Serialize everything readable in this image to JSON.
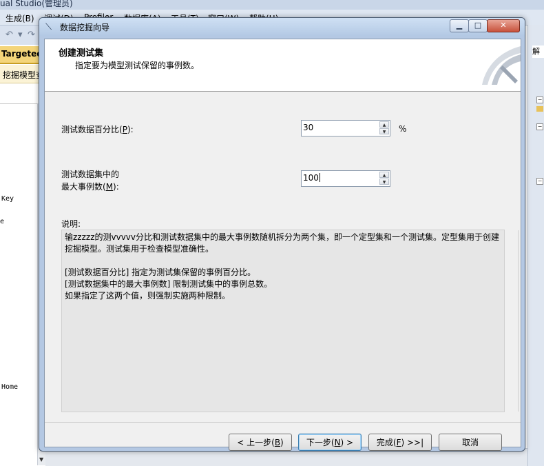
{
  "ide": {
    "title_fragment": "ual Studio(管理员)",
    "menu": [
      "生成(B)",
      "调试(D)",
      "Profiler",
      "数据库(A)",
      "工具(T)",
      "窗口(W)",
      "帮助(H)"
    ],
    "doc_tab_targeted": "Targeted",
    "doc_tab_model": "挖掘模型查",
    "code_fragment_key": "Key",
    "code_fragment_e": "e",
    "code_fragment_home": "Home",
    "right_panel_tab": "解"
  },
  "dialog": {
    "title": "数据挖掘向导",
    "header_title": "创建测试集",
    "header_subtitle": "指定要为模型测试保留的事例数。",
    "percent_label_pre": "测试数据百分比(",
    "percent_label_key": "P",
    "percent_label_post": "):",
    "percent_value": "30",
    "percent_unit": "%",
    "maxcases_label_line1": "测试数据集中的",
    "maxcases_label_pre": "最大事例数(",
    "maxcases_label_key": "M",
    "maxcases_label_post": "):",
    "maxcases_value": "100",
    "description_label": "说明:",
    "description_lines": [
      "输zzzzz的测vvvvv分比和测试数据集中的最大事例数随机拆分为两个集，即一个定型集和一个测试集。定型集用于创建",
      "挖掘模型。测试集用于检查模型准确性。",
      "",
      "[测试数据百分比] 指定为测试集保留的事例百分比。",
      "[测试数据集中的最大事例数] 限制测试集中的事例总数。",
      "如果指定了这两个值，则强制实施两种限制。"
    ],
    "buttons": {
      "back": {
        "pre": "< 上一步(",
        "key": "B",
        "post": ")"
      },
      "next": {
        "pre": "下一步(",
        "key": "N",
        "post": ") >"
      },
      "finish": {
        "pre": "完成(",
        "key": "F",
        "post": ") >>|"
      },
      "cancel": "取消"
    }
  }
}
